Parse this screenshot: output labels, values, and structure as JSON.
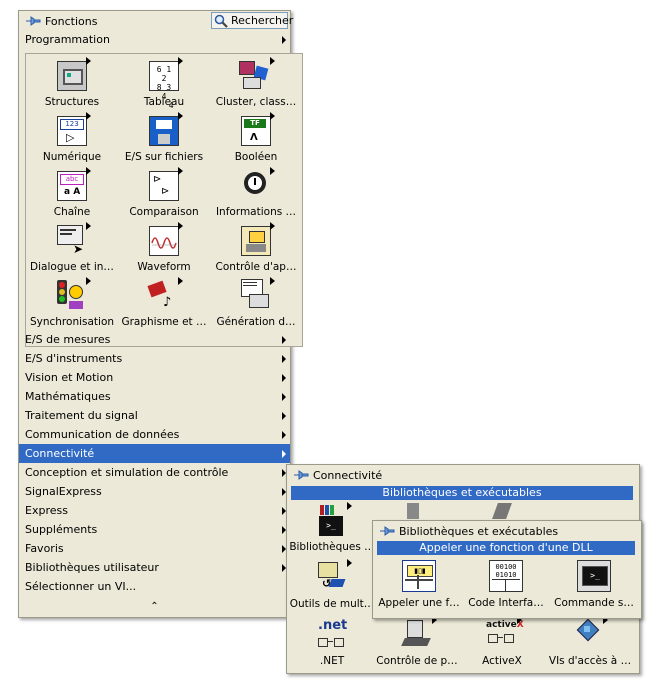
{
  "functions": {
    "title": "Fonctions",
    "search_label": "Rechercher",
    "top_item": "Programmation",
    "palette": [
      {
        "label": "Structures",
        "icon": "structures-icon"
      },
      {
        "label": "Tableau",
        "icon": "array-icon"
      },
      {
        "label": "Cluster, class…",
        "icon": "cluster-icon"
      },
      {
        "label": "Numérique",
        "icon": "numeric-icon"
      },
      {
        "label": "E/S sur fichiers",
        "icon": "file-io-icon"
      },
      {
        "label": "Booléen",
        "icon": "boolean-icon"
      },
      {
        "label": "Chaîne",
        "icon": "string-icon"
      },
      {
        "label": "Comparaison",
        "icon": "comparison-icon"
      },
      {
        "label": "Informations …",
        "icon": "timing-icon"
      },
      {
        "label": "Dialogue et in…",
        "icon": "dialog-icon"
      },
      {
        "label": "Waveform",
        "icon": "waveform-icon"
      },
      {
        "label": "Contrôle d'ap…",
        "icon": "app-control-icon"
      },
      {
        "label": "Synchronisation",
        "icon": "synchronization-icon"
      },
      {
        "label": "Graphisme et …",
        "icon": "graphics-icon"
      },
      {
        "label": "Génération d…",
        "icon": "report-icon"
      }
    ],
    "items": [
      "E/S de mesures",
      "E/S d'instruments",
      "Vision et Motion",
      "Mathématiques",
      "Traitement du signal",
      "Communication de données",
      "Connectivité",
      "Conception et simulation de contrôle",
      "SignalExpress",
      "Express",
      "Suppléments",
      "Favoris",
      "Bibliothèques utilisateur",
      "Sélectionner un VI..."
    ],
    "selected_item": "Connectivité",
    "more_glyph": "⌃"
  },
  "connectivity": {
    "title": "Connectivité",
    "header": "Bibliothèques et exécutables",
    "icons": [
      {
        "label": "Bibliothèques …"
      },
      {
        "label": "Outils de mult…"
      },
      {
        "label": ".NET"
      },
      {
        "label": "Contrôle de p…"
      },
      {
        "label": "ActiveX"
      },
      {
        "label": "VIs d'accès à …"
      }
    ]
  },
  "libraries": {
    "title": "Bibliothèques et exécutables",
    "header": "Appeler une fonction d'une DLL",
    "icons": [
      {
        "label": "Appeler une f…"
      },
      {
        "label": "Code Interfa…"
      },
      {
        "label": "Commande s…"
      }
    ]
  },
  "colors": {
    "selection": "#316ac5",
    "panel": "#ece9d8"
  }
}
